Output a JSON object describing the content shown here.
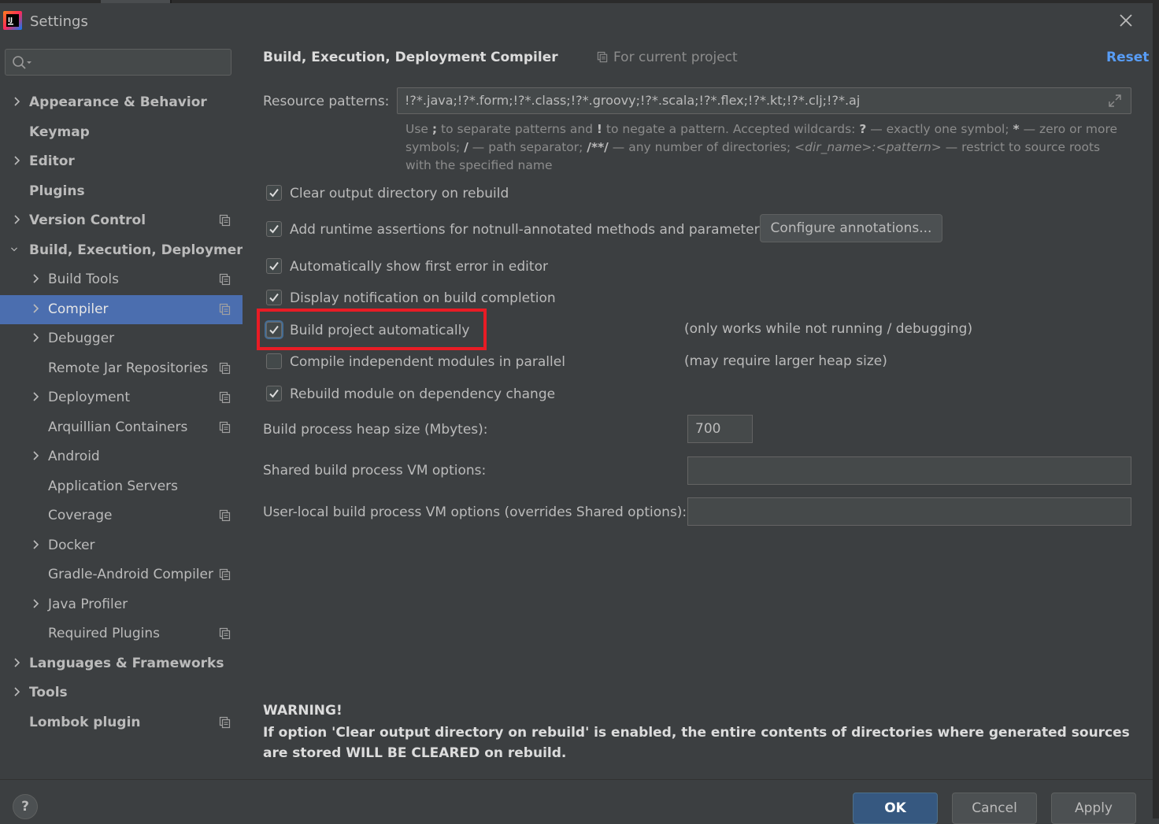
{
  "window": {
    "title": "Settings"
  },
  "search": {
    "placeholder": ""
  },
  "sidebar": {
    "items": [
      {
        "label": "Appearance & Behavior",
        "level": 0,
        "expandable": true,
        "expanded": false,
        "project_icon": false,
        "selected": false
      },
      {
        "label": "Keymap",
        "level": 0,
        "expandable": false,
        "expanded": false,
        "project_icon": false,
        "selected": false
      },
      {
        "label": "Editor",
        "level": 0,
        "expandable": true,
        "expanded": false,
        "project_icon": false,
        "selected": false
      },
      {
        "label": "Plugins",
        "level": 0,
        "expandable": false,
        "expanded": false,
        "project_icon": false,
        "selected": false
      },
      {
        "label": "Version Control",
        "level": 0,
        "expandable": true,
        "expanded": false,
        "project_icon": true,
        "selected": false
      },
      {
        "label": "Build, Execution, Deployment",
        "level": 0,
        "expandable": true,
        "expanded": true,
        "project_icon": false,
        "selected": false
      },
      {
        "label": "Build Tools",
        "level": 1,
        "expandable": true,
        "expanded": false,
        "project_icon": true,
        "selected": false
      },
      {
        "label": "Compiler",
        "level": 1,
        "expandable": true,
        "expanded": false,
        "project_icon": true,
        "selected": true
      },
      {
        "label": "Debugger",
        "level": 1,
        "expandable": true,
        "expanded": false,
        "project_icon": false,
        "selected": false
      },
      {
        "label": "Remote Jar Repositories",
        "level": 1,
        "expandable": false,
        "expanded": false,
        "project_icon": true,
        "selected": false
      },
      {
        "label": "Deployment",
        "level": 1,
        "expandable": true,
        "expanded": false,
        "project_icon": true,
        "selected": false
      },
      {
        "label": "Arquillian Containers",
        "level": 1,
        "expandable": false,
        "expanded": false,
        "project_icon": true,
        "selected": false
      },
      {
        "label": "Android",
        "level": 1,
        "expandable": true,
        "expanded": false,
        "project_icon": false,
        "selected": false
      },
      {
        "label": "Application Servers",
        "level": 1,
        "expandable": false,
        "expanded": false,
        "project_icon": false,
        "selected": false
      },
      {
        "label": "Coverage",
        "level": 1,
        "expandable": false,
        "expanded": false,
        "project_icon": true,
        "selected": false
      },
      {
        "label": "Docker",
        "level": 1,
        "expandable": true,
        "expanded": false,
        "project_icon": false,
        "selected": false
      },
      {
        "label": "Gradle-Android Compiler",
        "level": 1,
        "expandable": false,
        "expanded": false,
        "project_icon": true,
        "selected": false
      },
      {
        "label": "Java Profiler",
        "level": 1,
        "expandable": true,
        "expanded": false,
        "project_icon": false,
        "selected": false
      },
      {
        "label": "Required Plugins",
        "level": 1,
        "expandable": false,
        "expanded": false,
        "project_icon": true,
        "selected": false
      },
      {
        "label": "Languages & Frameworks",
        "level": 0,
        "expandable": true,
        "expanded": false,
        "project_icon": false,
        "selected": false
      },
      {
        "label": "Tools",
        "level": 0,
        "expandable": true,
        "expanded": false,
        "project_icon": false,
        "selected": false
      },
      {
        "label": "Lombok plugin",
        "level": 0,
        "expandable": false,
        "expanded": false,
        "project_icon": true,
        "selected": false
      }
    ]
  },
  "header": {
    "breadcrumb_parent": "Build, Execution, Deployment",
    "breadcrumb_current": "Compiler",
    "scope": "For current project",
    "reset": "Reset"
  },
  "resource": {
    "label": "Resource patterns:",
    "value": "!?*.java;!?*.form;!?*.class;!?*.groovy;!?*.scala;!?*.flex;!?*.kt;!?*.clj;!?*.aj",
    "hint_parts": [
      {
        "t": "Use ",
        "s": "n"
      },
      {
        "t": ";",
        "s": "b"
      },
      {
        "t": " to separate patterns and ",
        "s": "n"
      },
      {
        "t": "!",
        "s": "b"
      },
      {
        "t": " to negate a pattern. Accepted wildcards: ",
        "s": "n"
      },
      {
        "t": "?",
        "s": "b"
      },
      {
        "t": " — exactly one symbol; ",
        "s": "n"
      },
      {
        "t": "*",
        "s": "b"
      },
      {
        "t": " — zero or more symbols; ",
        "s": "n"
      },
      {
        "t": "/",
        "s": "b"
      },
      {
        "t": " — path separator; ",
        "s": "n"
      },
      {
        "t": "/**/",
        "s": "b"
      },
      {
        "t": " — any number of directories; ",
        "s": "n"
      },
      {
        "t": "<dir_name>:<pattern>",
        "s": "i"
      },
      {
        "t": " — restrict to source roots with the specified name",
        "s": "n"
      }
    ]
  },
  "options": {
    "clear_output": {
      "label": "Clear output directory on rebuild",
      "checked": true
    },
    "runtime_assertions": {
      "label": "Add runtime assertions for notnull-annotated methods and parameters",
      "checked": true
    },
    "configure_annotations": "Configure annotations...",
    "show_first_error": {
      "label": "Automatically show first error in editor",
      "checked": true
    },
    "display_notification": {
      "label": "Display notification on build completion",
      "checked": true
    },
    "build_automatically": {
      "label": "Build project automatically",
      "checked": true,
      "note": "(only works while not running / debugging)"
    },
    "compile_parallel": {
      "label": "Compile independent modules in parallel",
      "checked": false,
      "note": "(may require larger heap size)"
    },
    "rebuild_on_dependency": {
      "label": "Rebuild module on dependency change",
      "checked": true
    }
  },
  "fields": {
    "heap_label": "Build process heap size (Mbytes):",
    "heap_value": "700",
    "shared_label": "Shared build process VM options:",
    "shared_value": "",
    "local_label": "User-local build process VM options (overrides Shared options):",
    "local_value": ""
  },
  "warning": {
    "title": "WARNING!",
    "body": "If option 'Clear output directory on rebuild' is enabled, the entire contents of directories where generated sources are stored WILL BE CLEARED on rebuild."
  },
  "footer": {
    "help": "?",
    "ok": "OK",
    "cancel": "Cancel",
    "apply": "Apply"
  },
  "colors": {
    "background": "#3c3f41",
    "selection": "#4b6eaf",
    "link": "#589df6",
    "highlight_box": "#e81c25",
    "ok_button": "#365880"
  },
  "icons": [
    "intellij-logo-icon",
    "close-icon",
    "search-icon",
    "chevron-right-icon",
    "chevron-down-icon",
    "project-scope-icon",
    "expand-icon",
    "checkmark-icon",
    "help-icon"
  ]
}
